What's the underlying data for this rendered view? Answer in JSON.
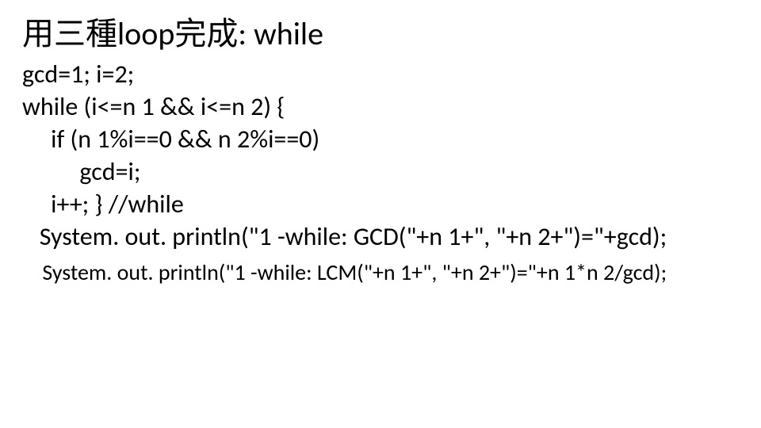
{
  "slide": {
    "title": "用三種loop完成: while",
    "lines": [
      "gcd=1; i=2;",
      "while (i<=n 1 && i<=n 2) {",
      "     if (n 1%i==0 && n 2%i==0)",
      "          gcd=i;",
      "     i++; } //while",
      "   System. out. println(\"1 -while: GCD(\"+n 1+\", \"+n 2+\")=\"+gcd);"
    ],
    "last_line": "    System. out. println(\"1 -while: LCM(\"+n 1+\", \"+n 2+\")=\"+n 1*n 2/gcd);"
  }
}
